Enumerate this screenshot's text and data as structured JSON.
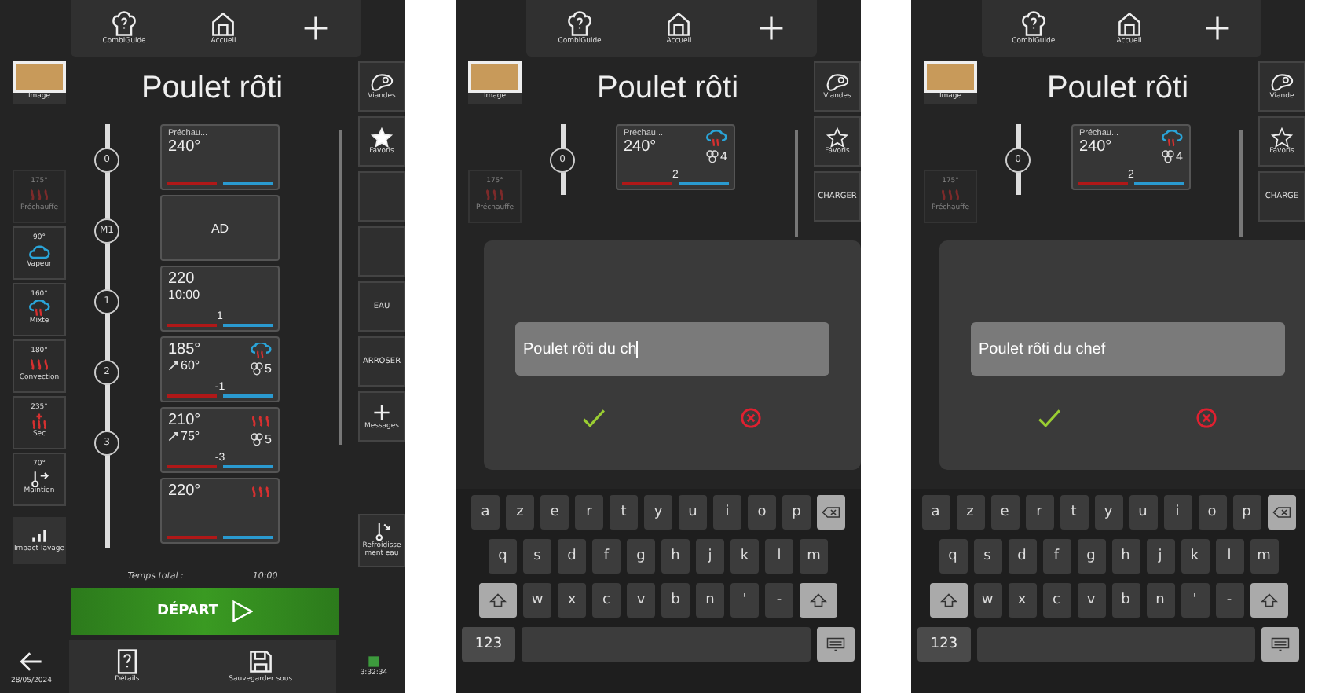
{
  "screens": [
    {
      "kind": "editor",
      "top_bar": [
        {
          "kind": "guide",
          "label": "CombiGuide"
        },
        {
          "kind": "home",
          "label": "Accueil"
        },
        {
          "kind": "add"
        }
      ],
      "image_label": "Image",
      "title": "Poulet rôti",
      "modes": [
        {
          "kind": "heat",
          "temp": "175°",
          "label": "Préchauffe",
          "disabled": true
        },
        {
          "kind": "steam",
          "temp": "90°",
          "label": "Vapeur",
          "disabled": false
        },
        {
          "kind": "mixed",
          "temp": "160°",
          "label": "Mixte",
          "disabled": false
        },
        {
          "kind": "heat",
          "temp": "180°",
          "label": "Convection",
          "disabled": false
        },
        {
          "kind": "dry",
          "temp": "235°",
          "label": "Sec",
          "disabled": false
        },
        {
          "kind": "hold",
          "temp": "70°",
          "label": "Maintien",
          "disabled": false
        }
      ],
      "impact_button": "Impact lavage",
      "steps": [
        {
          "marker": "0",
          "kind": "cook",
          "name": "Préchau...",
          "temp": "240°"
        },
        {
          "marker": "M1",
          "kind": "action",
          "label": "AD"
        },
        {
          "marker": "1",
          "kind": "cook",
          "temp": "220",
          "time": "10:00",
          "shelf": "1"
        },
        {
          "marker": "2",
          "kind": "cook",
          "temp": "185°",
          "probe": "60°",
          "icon": {
            "kind": "mixed"
          },
          "fan": "5",
          "shelf": "-1"
        },
        {
          "marker": "3",
          "kind": "cook",
          "temp": "210°",
          "probe": "75°",
          "icon": {
            "kind": "heat"
          },
          "fan": "5",
          "shelf": "-3"
        },
        {
          "kind": "cook",
          "temp": "220°",
          "icon": {
            "kind": "heat"
          }
        }
      ],
      "right_buttons": [
        {
          "kind": "meat",
          "label": "Viandes"
        },
        {
          "kind": "star",
          "label": "Favoris",
          "on": true
        },
        {
          "kind": "blank"
        },
        {
          "kind": "blank"
        },
        {
          "kind": "text",
          "label": "EAU"
        },
        {
          "kind": "text",
          "label": "ARROSER"
        },
        {
          "kind": "add",
          "label": "Messages"
        }
      ],
      "cooling_button": "Refroidissement eau",
      "total_label": "Temps total :",
      "total_time": "10:00",
      "start_button": "DÉPART",
      "bottom_bar": {
        "date": "28/05/2024",
        "details": "Détails",
        "save_as": "Sauvegarder sous",
        "clock": "3:32:34"
      }
    },
    {
      "kind": "dialog",
      "top_bar": [
        {
          "kind": "guide",
          "label": "CombiGuide"
        },
        {
          "kind": "home",
          "label": "Accueil"
        },
        {
          "kind": "add"
        }
      ],
      "image_label": "Image",
      "title": "Poulet rôti",
      "modes": [
        {
          "kind": "heat",
          "temp": "175°",
          "label": "Préchauffe",
          "disabled": true
        }
      ],
      "steps": [
        {
          "marker": "0",
          "kind": "cook",
          "name": "Préchau...",
          "temp": "240°",
          "icon": {
            "kind": "mixed"
          },
          "fan": "4",
          "shelf": "2"
        }
      ],
      "right_buttons": [
        {
          "kind": "meat",
          "label": "Viandes"
        },
        {
          "kind": "star",
          "label": "Favoris",
          "on": false
        },
        {
          "kind": "text",
          "label": "CHARGER"
        }
      ],
      "name_field": {
        "value": "Poulet rôti du ch",
        "focused": true
      },
      "keyboard": {
        "rows": [
          [
            "a",
            "z",
            "e",
            "r",
            "t",
            "y",
            "u",
            "i",
            "o",
            "p"
          ],
          [
            "q",
            "s",
            "d",
            "f",
            "g",
            "h",
            "j",
            "k",
            "l",
            "m"
          ],
          [
            "w",
            "x",
            "c",
            "v",
            "b",
            "n",
            "'",
            "-"
          ]
        ],
        "numbers_key": "123"
      }
    },
    {
      "kind": "dialog",
      "top_bar": [
        {
          "kind": "guide",
          "label": "CombiGuide"
        },
        {
          "kind": "home",
          "label": "Accueil"
        },
        {
          "kind": "add"
        }
      ],
      "image_label": "Image",
      "title": "Poulet rôti",
      "modes": [
        {
          "kind": "heat",
          "temp": "175°",
          "label": "Préchauffe",
          "disabled": true
        }
      ],
      "steps": [
        {
          "marker": "0",
          "kind": "cook",
          "name": "Préchau...",
          "temp": "240°",
          "icon": {
            "kind": "mixed"
          },
          "fan": "4",
          "shelf": "2"
        }
      ],
      "right_buttons": [
        {
          "kind": "meat",
          "label": "Viande"
        },
        {
          "kind": "star",
          "label": "Favoris",
          "on": false
        },
        {
          "kind": "text",
          "label": "CHARGE"
        }
      ],
      "name_field": {
        "value": "Poulet rôti du chef",
        "focused": false
      },
      "keyboard": {
        "rows": [
          [
            "a",
            "z",
            "e",
            "r",
            "t",
            "y",
            "u",
            "i",
            "o",
            "p"
          ],
          [
            "q",
            "s",
            "d",
            "f",
            "g",
            "h",
            "j",
            "k",
            "l",
            "m"
          ],
          [
            "w",
            "x",
            "c",
            "v",
            "b",
            "n",
            "'",
            "-"
          ]
        ],
        "numbers_key": "123"
      }
    }
  ]
}
